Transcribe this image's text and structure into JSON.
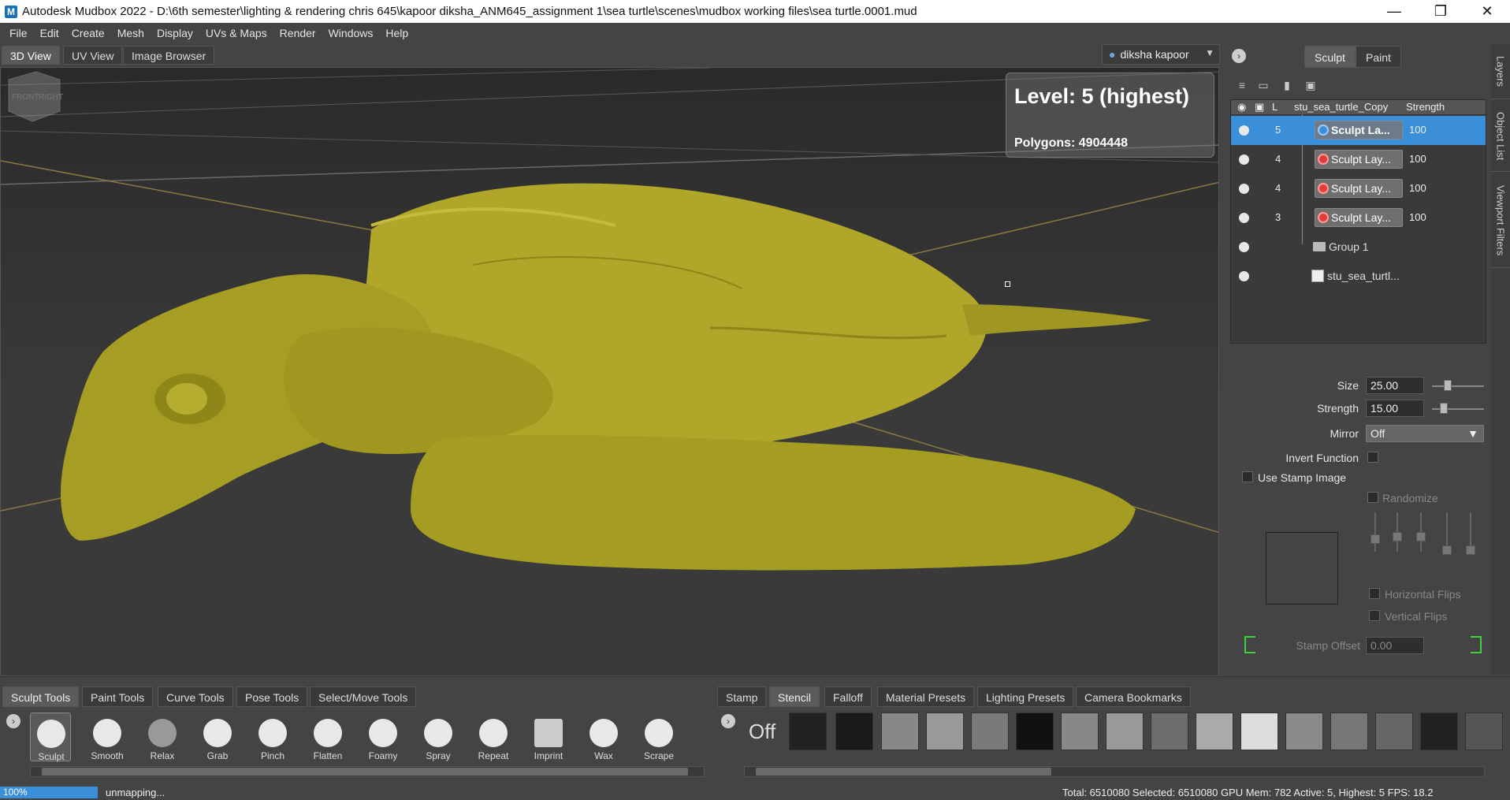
{
  "window": {
    "title": "Autodesk Mudbox 2022 - D:\\6th semester\\lighting & rendering chris 645\\kapoor diksha_ANM645_assignment 1\\sea turtle\\scenes\\mudbox working files\\sea turtle.0001.mud",
    "app_icon": "M",
    "minimize": "—",
    "restore": "❐",
    "close": "✕"
  },
  "menu": [
    "File",
    "Edit",
    "Create",
    "Mesh",
    "Display",
    "UVs & Maps",
    "Render",
    "Windows",
    "Help"
  ],
  "view_tabs": [
    "3D View",
    "UV View",
    "Image Browser"
  ],
  "user": {
    "name": "diksha kapoor",
    "icon": "person-icon"
  },
  "hud": {
    "level": "Level: 5 (highest)",
    "polygons": "Polygons: 4904448"
  },
  "viewcube_labels": {
    "front": "FRONT",
    "right": "RIGHT"
  },
  "right_panel": {
    "mode_tabs": [
      "Sculpt",
      "Paint"
    ],
    "side_tabs": [
      "Layers",
      "Object List",
      "Viewport Filters"
    ],
    "layer_headers": {
      "level": "L",
      "name": "stu_sea_turtle_Copy",
      "strength": "Strength"
    },
    "layers": [
      {
        "level": "5",
        "name": "Sculpt La...",
        "strength": "100",
        "selected": true
      },
      {
        "level": "4",
        "name": "Sculpt Lay...",
        "strength": "100"
      },
      {
        "level": "4",
        "name": "Sculpt Lay...",
        "strength": "100"
      },
      {
        "level": "3",
        "name": "Sculpt Lay...",
        "strength": "100"
      }
    ],
    "group_name": "Group 1",
    "mesh_name": "stu_sea_turtl...",
    "properties": {
      "size_label": "Size",
      "size_value": "25.00",
      "strength_label": "Strength",
      "strength_value": "15.00",
      "mirror_label": "Mirror",
      "mirror_value": "Off",
      "invert_label": "Invert Function",
      "stamp_label": "Use Stamp Image",
      "randomize_label": "Randomize",
      "hflips_label": "Horizontal Flips",
      "vflips_label": "Vertical Flips",
      "stamp_offset_label": "Stamp Offset",
      "stamp_offset_value": "0.00"
    }
  },
  "tool_tabs": [
    "Sculpt Tools",
    "Paint Tools",
    "Curve Tools",
    "Pose Tools",
    "Select/Move Tools"
  ],
  "tools": [
    "Sculpt",
    "Smooth",
    "Relax",
    "Grab",
    "Pinch",
    "Flatten",
    "Foamy",
    "Spray",
    "Repeat",
    "Imprint",
    "Wax",
    "Scrape"
  ],
  "stamp_tabs": [
    "Stamp",
    "Stencil",
    "Falloff",
    "Material Presets",
    "Lighting Presets",
    "Camera Bookmarks"
  ],
  "stamp_off": "Off",
  "status": {
    "progress": "100%",
    "message": "unmapping...",
    "stats": "Total: 6510080  Selected: 6510080 GPU Mem: 782  Active: 5, Highest: 5  FPS: 18.2"
  }
}
